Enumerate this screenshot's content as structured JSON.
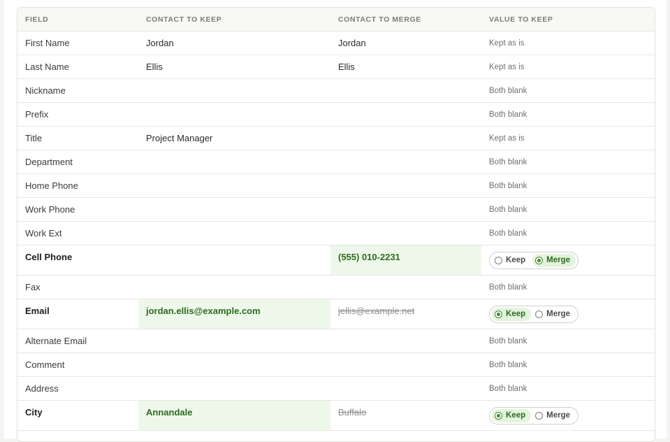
{
  "headers": {
    "field": "FIELD",
    "keep": "CONTACT TO KEEP",
    "merge": "CONTACT TO MERGE",
    "value": "VALUE TO KEEP"
  },
  "toggle_labels": {
    "keep": "Keep",
    "merge": "Merge"
  },
  "rows": [
    {
      "field": "First Name",
      "keep": "Jordan",
      "merge": "Jordan",
      "status": "Kept as is"
    },
    {
      "field": "Last Name",
      "keep": "Ellis",
      "merge": "Ellis",
      "status": "Kept as is"
    },
    {
      "field": "Nickname",
      "keep": "",
      "merge": "",
      "status": "Both blank"
    },
    {
      "field": "Prefix",
      "keep": "",
      "merge": "",
      "status": "Both blank"
    },
    {
      "field": "Title",
      "keep": "Project Manager",
      "merge": "",
      "status": "Kept as is"
    },
    {
      "field": "Department",
      "keep": "",
      "merge": "",
      "status": "Both blank"
    },
    {
      "field": "Home Phone",
      "keep": "",
      "merge": "",
      "status": "Both blank"
    },
    {
      "field": "Work Phone",
      "keep": "",
      "merge": "",
      "status": "Both blank"
    },
    {
      "field": "Work Ext",
      "keep": "",
      "merge": "",
      "status": "Both blank"
    },
    {
      "field": "Cell Phone",
      "keep": "",
      "merge": "(555) 010-2231",
      "choice": "merge"
    },
    {
      "field": "Fax",
      "keep": "",
      "merge": "",
      "status": "Both blank"
    },
    {
      "field": "Email",
      "keep": "jordan.ellis@example.com",
      "merge": "jellis@example.net",
      "choice": "keep"
    },
    {
      "field": "Alternate Email",
      "keep": "",
      "merge": "",
      "status": "Both blank"
    },
    {
      "field": "Comment",
      "keep": "",
      "merge": "",
      "status": "Both blank"
    },
    {
      "field": "Address",
      "keep": "",
      "merge": "",
      "status": "Both blank"
    },
    {
      "field": "City",
      "keep": "Annandale",
      "merge": "Buffalo",
      "choice": "keep"
    }
  ],
  "colors": {
    "chosen_bg": "#eef8ea",
    "chosen_text": "#2d6a1f",
    "radio_accent": "#3f8a2b"
  }
}
